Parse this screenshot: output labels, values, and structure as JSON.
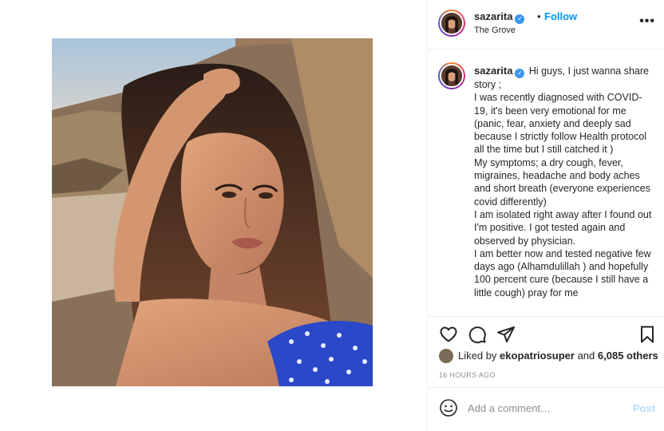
{
  "post": {
    "photo_alt": "selfie"
  },
  "header": {
    "username": "sazarita",
    "separator": "•",
    "follow_label": "Follow",
    "location": "The Grove",
    "more_label": "•••"
  },
  "caption": {
    "username": "sazarita",
    "first_line": "Hi guys, I just wanna share story ;",
    "lines": [
      "I was recently diagnosed with COVID-19, it's been very emotional for me (panic, fear, anxiety and deeply sad because I strictly follow Health protocol all the time but I still catched it )",
      "My symptoms; a dry cough, fever, migraines, headache and body aches and short breath (everyone experiences covid differently)",
      "I am isolated right away after I found out I'm positive. I got tested again and observed by physician.",
      "I am better now and tested negative few days ago (Alhamdulillah ) and hopefully 100 percent cure (because I still have a little cough) pray for me"
    ]
  },
  "actions": {
    "like_icon": "heart-icon",
    "comment_icon": "comment-icon",
    "share_icon": "paper-plane-icon",
    "save_icon": "bookmark-icon"
  },
  "likes": {
    "prefix": "Liked by ",
    "user": "ekopatriosuper",
    "middle": " and ",
    "others": "6,085 others"
  },
  "timestamp": "16 HOURS AGO",
  "comment_box": {
    "placeholder": "Add a comment…",
    "post_label": "Post"
  },
  "colors": {
    "link_blue": "#0095f6",
    "post_disabled": "#b2dffc",
    "muted": "#8e8e8e"
  }
}
